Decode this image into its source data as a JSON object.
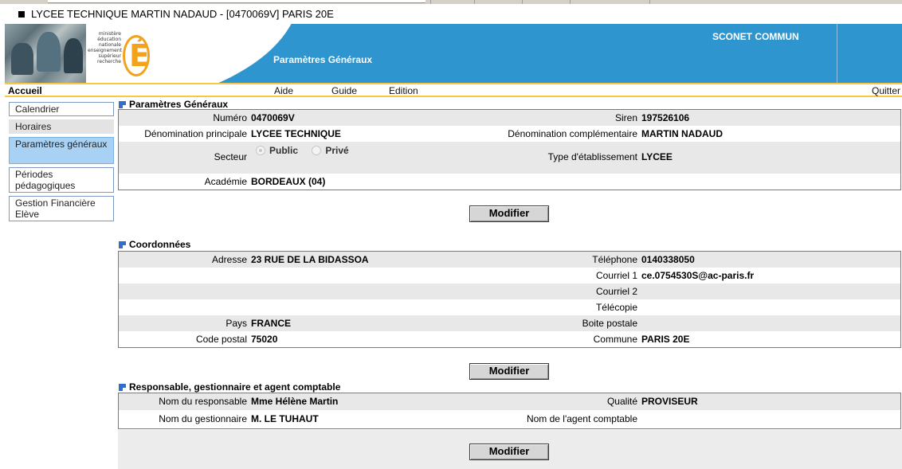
{
  "window": {
    "title": "LYCEE TECHNIQUE MARTIN NADAUD - [0470069V] PARIS 20E"
  },
  "banner": {
    "logo_text": [
      "ministère",
      "éducation",
      "nationale",
      "enseignement",
      "supérieur",
      "recherche"
    ],
    "logo_letter": "É",
    "page_heading": "Paramètres Généraux",
    "app_name": "SCONET COMMUN",
    "colors": {
      "banner_blue": "#2f95cf",
      "accent_yellow": "#f7c843",
      "logo_orange": "#f3a21c"
    }
  },
  "menu": {
    "home": "Accueil",
    "help": "Aide",
    "guide": "Guide",
    "edition": "Edition",
    "quit": "Quitter"
  },
  "sidebar": {
    "items": [
      {
        "label": "Calendrier"
      },
      {
        "label": "Horaires"
      },
      {
        "label": "Paramètres généraux",
        "active": true
      },
      {
        "label": "Périodes pédagogiques"
      },
      {
        "label": "Gestion Financière Elève"
      }
    ]
  },
  "general": {
    "title": "Paramètres Généraux",
    "numero_label": "Numéro",
    "numero": "0470069V",
    "siren_label": "Siren",
    "siren": "197526106",
    "denom_principale_label": "Dénomination principale",
    "denom_principale": "LYCEE TECHNIQUE",
    "denom_complementaire_label": "Dénomination complémentaire",
    "denom_complementaire": "MARTIN NADAUD",
    "secteur_label": "Secteur",
    "secteur_public": "Public",
    "secteur_prive": "Privé",
    "secteur_selected": "Public",
    "type_label": "Type d'établissement",
    "type": "LYCEE",
    "academie_label": "Académie",
    "academie": "BORDEAUX (04)"
  },
  "coords": {
    "title": "Coordonnées",
    "adresse_label": "Adresse",
    "adresse": "23 RUE DE LA BIDASSOA",
    "telephone_label": "Téléphone",
    "telephone": "0140338050",
    "courriel1_label": "Courriel 1",
    "courriel1": "ce.0754530S@ac-paris.fr",
    "courriel2_label": "Courriel 2",
    "courriel2": "",
    "telecopie_label": "Télécopie",
    "telecopie": "",
    "pays_label": "Pays",
    "pays": "FRANCE",
    "boite_label": "Boite postale",
    "boite": "",
    "cp_label": "Code postal",
    "cp": "75020",
    "commune_label": "Commune",
    "commune": "PARIS 20E"
  },
  "resp": {
    "title": "Responsable, gestionnaire et agent comptable",
    "responsable_label": "Nom du responsable",
    "responsable": "Mme Hélène Martin",
    "qualite_label": "Qualité",
    "qualite": "PROVISEUR",
    "gestionnaire_label": "Nom du gestionnaire",
    "gestionnaire": "M. LE TUHAUT",
    "agent_label": "Nom de l'agent comptable",
    "agent": ""
  },
  "buttons": {
    "modify": "Modifier"
  }
}
